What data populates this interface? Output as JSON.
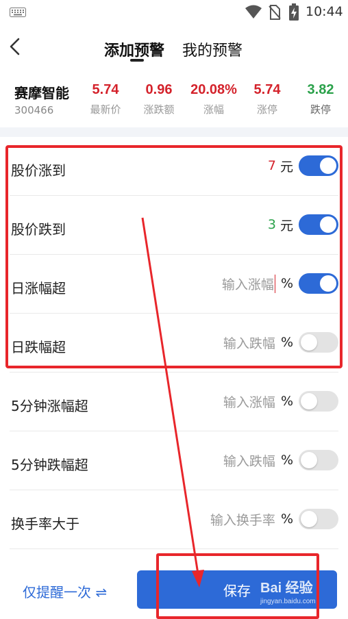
{
  "status": {
    "time": "10:44"
  },
  "header": {
    "tabs": [
      {
        "label": "添加预警"
      },
      {
        "label": "我的预警"
      }
    ]
  },
  "stock": {
    "name": "赛摩智能",
    "code": "300466",
    "stats": [
      {
        "value": "5.74",
        "label": "最新价",
        "color": "#d4222b"
      },
      {
        "value": "0.96",
        "label": "涨跌额",
        "color": "#d4222b"
      },
      {
        "value": "20.08%",
        "label": "涨幅",
        "color": "#d4222b"
      },
      {
        "value": "5.74",
        "label": "涨停",
        "color": "#d4222b"
      },
      {
        "value": "3.82",
        "label": "跌停",
        "color": "#2aa14a"
      }
    ]
  },
  "rows": [
    {
      "label": "股价涨到",
      "value": "7",
      "unit": "元",
      "toggle": "on"
    },
    {
      "label": "股价跌到",
      "value": "3",
      "unit": "元",
      "toggle": "on"
    },
    {
      "label": "日涨幅超",
      "placeholder": "输入涨幅",
      "unit": "%",
      "toggle": "on"
    },
    {
      "label": "日跌幅超",
      "placeholder": "输入跌幅",
      "unit": "%",
      "toggle": "off"
    },
    {
      "label": "5分钟涨幅超",
      "placeholder": "输入涨幅",
      "unit": "%",
      "toggle": "off"
    },
    {
      "label": "5分钟跌幅超",
      "placeholder": "输入跌幅",
      "unit": "%",
      "toggle": "off"
    },
    {
      "label": "换手率大于",
      "placeholder": "输入换手率",
      "unit": "%",
      "toggle": "off"
    }
  ],
  "footer": {
    "remind_label": "仅提醒一次 ⇌",
    "save_label": "保存"
  },
  "watermark": {
    "line1": "Bai 经验",
    "line2": "jingyan.baidu.com"
  },
  "colors": {
    "accent": "#2d6ad7",
    "up": "#d4222b",
    "down": "#2aa14a",
    "annotation": "#e8262b"
  }
}
